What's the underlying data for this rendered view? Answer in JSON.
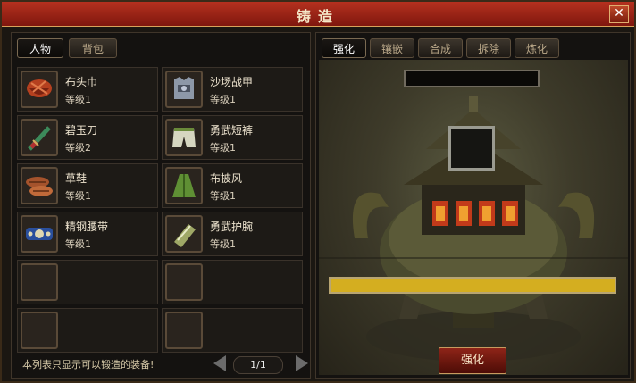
{
  "window": {
    "title": "铸造",
    "close": "✕"
  },
  "left_tabs": [
    {
      "label": "人物"
    },
    {
      "label": "背包"
    }
  ],
  "right_tabs": [
    {
      "label": "强化"
    },
    {
      "label": "镶嵌"
    },
    {
      "label": "合成"
    },
    {
      "label": "拆除"
    },
    {
      "label": "炼化"
    }
  ],
  "items": [
    {
      "name": "布头巾",
      "level": "等级1",
      "icon": "red-headscarf-icon",
      "color": "#b5401f"
    },
    {
      "name": "沙场战甲",
      "level": "等级1",
      "icon": "battle-armor-icon",
      "color": "#8d98a8"
    },
    {
      "name": "碧玉刀",
      "level": "等级2",
      "icon": "jade-sword-icon",
      "color": "#3c8a5a"
    },
    {
      "name": "勇武短裤",
      "level": "等级1",
      "icon": "shorts-icon",
      "color": "#d6d6c0"
    },
    {
      "name": "草鞋",
      "level": "等级1",
      "icon": "straw-sandals-icon",
      "color": "#a5532c"
    },
    {
      "name": "布披风",
      "level": "等级1",
      "icon": "green-cloak-icon",
      "color": "#5f8f34"
    },
    {
      "name": "精钢腰带",
      "level": "等级1",
      "icon": "steel-belt-icon",
      "color": "#2a4f9c"
    },
    {
      "name": "勇武护腕",
      "level": "等级1",
      "icon": "bracer-icon",
      "color": "#9fa866"
    }
  ],
  "hint": "本列表只显示可以锻造的装备!",
  "pager": {
    "text": "1/1"
  },
  "forge": {
    "progress": 1.0,
    "progress_color": "#d4ae20",
    "action_label": "强化"
  }
}
